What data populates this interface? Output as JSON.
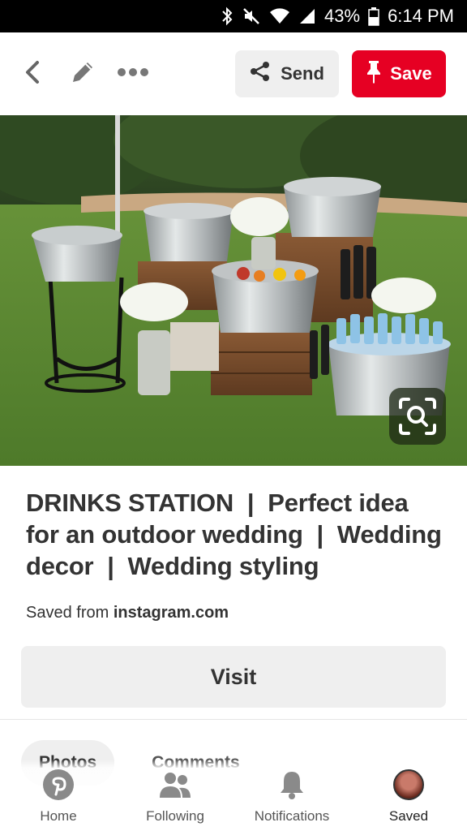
{
  "status_bar": {
    "battery": "43%",
    "time": "6:14 PM",
    "icons": [
      "bluetooth-icon",
      "mute-icon",
      "wifi-icon",
      "signal-icon",
      "battery-icon"
    ]
  },
  "toolbar": {
    "back_icon": "chevron-left-icon",
    "edit_icon": "pencil-icon",
    "more_icon": "more-dots-icon",
    "send_label": "Send",
    "save_label": "Save"
  },
  "pin": {
    "title": "DRINKS STATION  |  Perfect idea for an outdoor wedding  |  Wedding decor  |  Wedding styling",
    "saved_from_prefix": "Saved from",
    "saved_from_source": "instagram.com",
    "visit_label": "Visit"
  },
  "tabs": [
    {
      "label": "Photos",
      "active": true
    },
    {
      "label": "Comments",
      "active": false
    }
  ],
  "bottom_nav": [
    {
      "label": "Home",
      "icon": "pinterest-logo-icon"
    },
    {
      "label": "Following",
      "icon": "people-icon"
    },
    {
      "label": "Notifications",
      "icon": "bell-icon"
    },
    {
      "label": "Saved",
      "icon": "avatar"
    }
  ],
  "colors": {
    "brand_red": "#e60023",
    "button_gray": "#efefef",
    "text": "#333333"
  }
}
